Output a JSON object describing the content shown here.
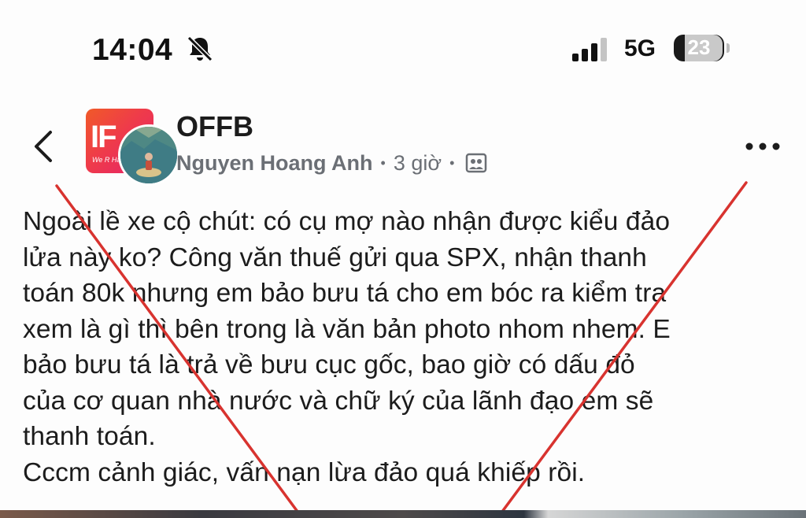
{
  "status_bar": {
    "time": "14:04",
    "network": "5G",
    "battery": "23",
    "battery_level": 0.23,
    "icons": [
      "bell-slash-icon",
      "signal-bars-icon",
      "battery-icon"
    ]
  },
  "post": {
    "group_name": "OFFB",
    "group_avatar_text": "IF",
    "group_avatar_sub": "We R Ha",
    "author": "Nguyen Hoang Anh",
    "time": "3 giờ",
    "icons": [
      "back-chevron-icon",
      "group-photo-icon",
      "more-dots-icon"
    ],
    "body": "Ngoài lề xe cộ chút: có cụ mợ nào nhận được kiểu đảo\nlửa này ko? Công văn thuế gửi qua SPX, nhận thanh\ntoán 80k nhưng em bảo bưu tá cho em bóc ra kiểm tra\nxem là gì thì bên trong là văn bản photo nhom nhem. E\nbảo bưu tá là trả về bưu cục gốc, bao giờ có dấu đỏ\ncủa cơ quan nhà nước và chữ ký của lãnh đạo em sẽ\nthanh toán.\nCccm cảnh giác, vấn nạn lừa đảo quá khiếp rồi."
  },
  "overlay": {
    "cross_color": "#d8332f"
  }
}
